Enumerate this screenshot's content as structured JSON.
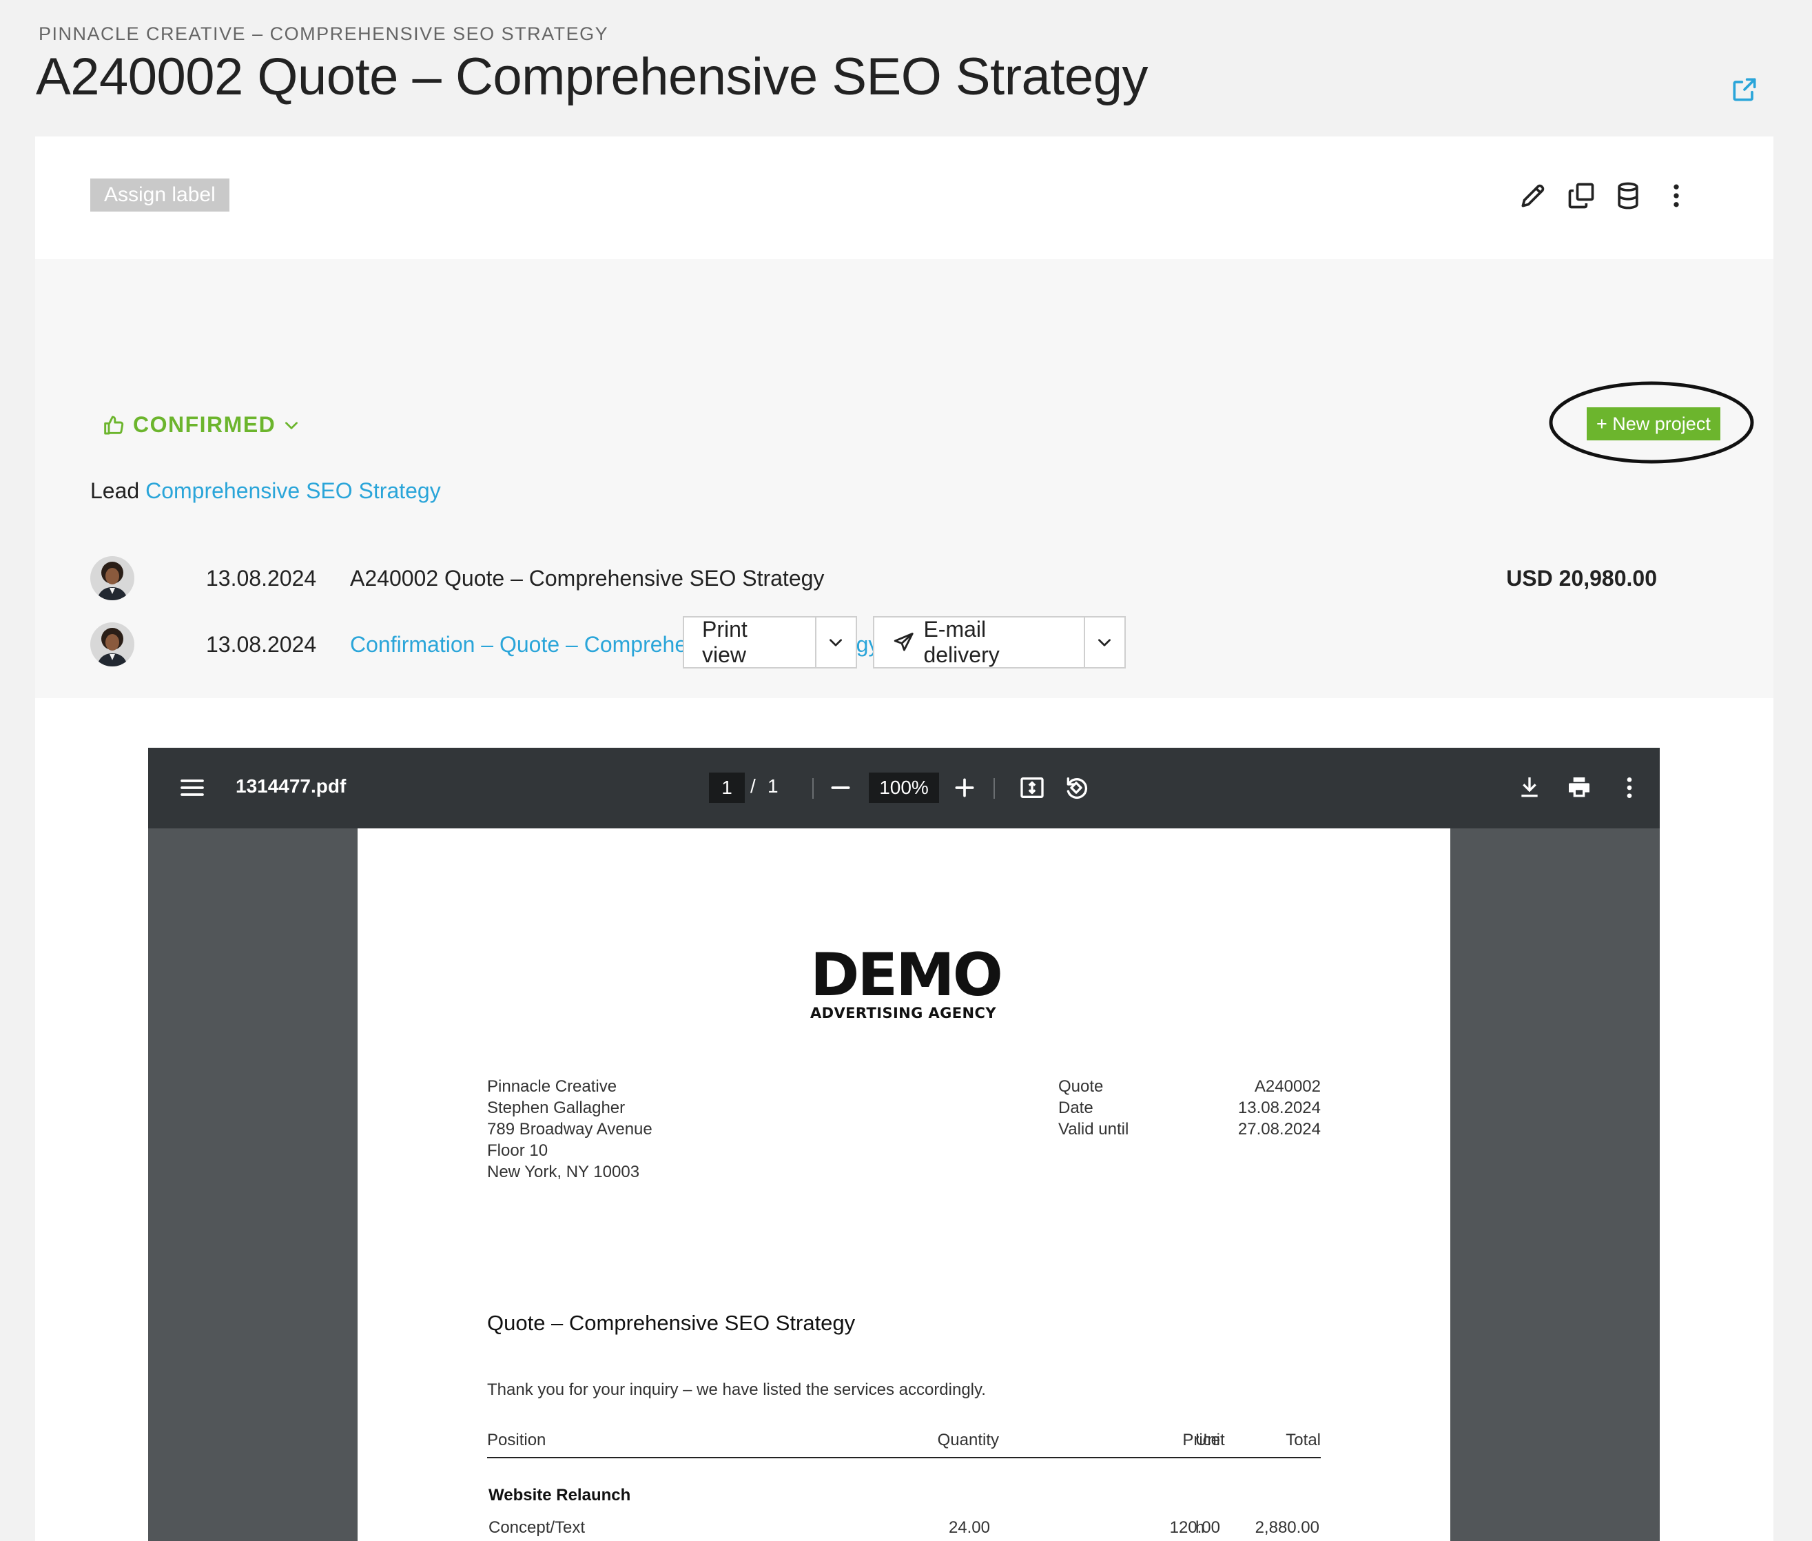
{
  "header": {
    "breadcrumb": "PINNACLE CREATIVE – COMPREHENSIVE SEO STRATEGY",
    "title": "A240002 Quote – Comprehensive SEO Strategy"
  },
  "toolbar": {
    "assign_label": "Assign label"
  },
  "status": {
    "label": "CONFIRMED",
    "color": "#6cb52d"
  },
  "new_project_label": "+ New project",
  "lead": {
    "prefix": "Lead",
    "link": "Comprehensive SEO Strategy"
  },
  "documents": [
    {
      "date": "13.08.2024",
      "title": "A240002 Quote – Comprehensive SEO Strategy",
      "amount": "USD 20,980.00"
    },
    {
      "date": "13.08.2024",
      "title": "Confirmation – Quote – Comprehensive SEO Strategy"
    }
  ],
  "actions": {
    "print_view": "Print view",
    "email_delivery": "E-mail delivery"
  },
  "pdf_viewer": {
    "filename": "1314477.pdf",
    "current_page": "1",
    "page_separator": "/",
    "total_pages": "1",
    "zoom": "100%"
  },
  "document": {
    "logo_main": "DEMO",
    "logo_sub": "ADVERTISING AGENCY",
    "address": [
      "Pinnacle Creative",
      "Stephen Gallagher",
      "789 Broadway Avenue",
      "Floor 10",
      "New York, NY 10003"
    ],
    "meta": [
      {
        "label": "Quote",
        "value": "A240002"
      },
      {
        "label": "Date",
        "value": "13.08.2024"
      },
      {
        "label": "Valid until",
        "value": "27.08.2024"
      }
    ],
    "heading": "Quote – Comprehensive SEO Strategy",
    "intro": "Thank you for your inquiry – we have listed the services accordingly.",
    "columns": {
      "position": "Position",
      "quantity": "Quantity",
      "unit": "Unit",
      "price": "Price",
      "total": "Total"
    },
    "section": "Website Relaunch",
    "rows": [
      {
        "position": "Concept/Text",
        "quantity": "24.00",
        "unit": "h",
        "price": "120.00",
        "total": "2,880.00"
      }
    ]
  },
  "colors": {
    "accent_green": "#6cb52d",
    "link_blue": "#2aa5d9",
    "viewer_bar": "#323639",
    "viewer_bg": "#525659"
  },
  "icons": [
    "share-icon",
    "pencil-icon",
    "copy-icon",
    "database-icon",
    "more-vertical-icon",
    "thumbs-up-icon",
    "chevron-down-icon",
    "send-icon",
    "menu-icon",
    "minus-icon",
    "plus-icon",
    "fit-page-icon",
    "rotate-icon",
    "download-icon",
    "print-icon"
  ]
}
